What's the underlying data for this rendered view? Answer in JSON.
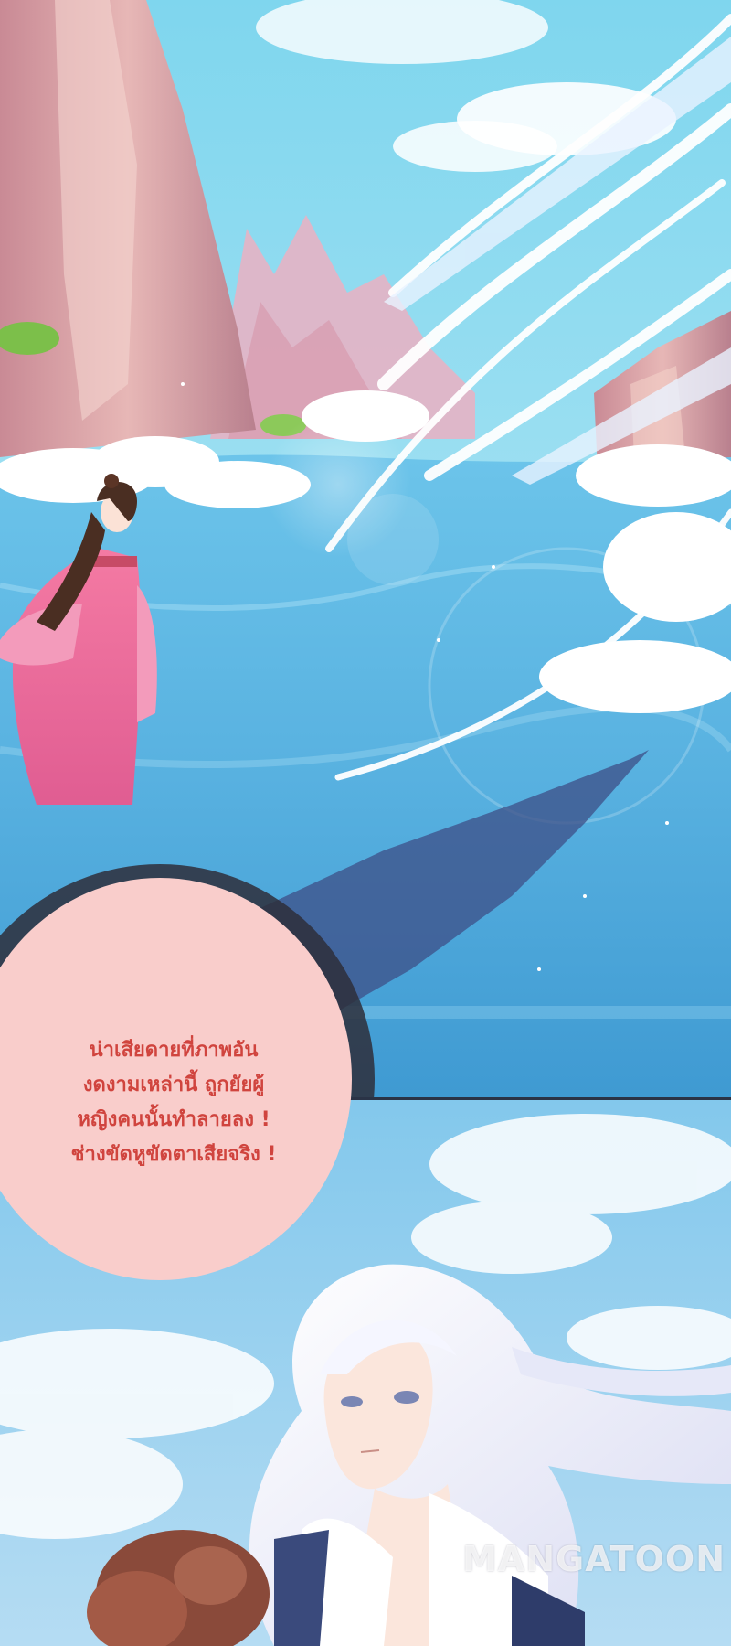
{
  "speech_bubble": {
    "lines": [
      "น่าเสียดายที่ภาพอัน",
      "งดงามเหล่านี้ ถูกยัยผู้",
      "หญิงคนนั้นทำลายลง !",
      "ช่างขัดหูขัดตาเสียจริง !"
    ]
  },
  "watermark": {
    "text": "MANGATOON"
  },
  "colors": {
    "sky": "#8fdcef",
    "water": "#5cb8e4",
    "bubble_fill": "#f9cdcb",
    "bubble_text": "#d0443e",
    "dress": "#f07fa8",
    "silver_hair": "#eef0fb"
  }
}
